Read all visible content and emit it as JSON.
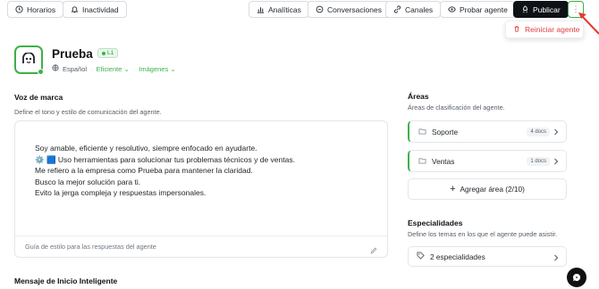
{
  "toolbar": {
    "horarios": "Horarios",
    "inactividad": "Inactividad",
    "analiticas": "Analíticas",
    "conversaciones": "Conversaciones",
    "canales": "Canales",
    "probar": "Probar agente",
    "publicar": "Publicar"
  },
  "dropdown": {
    "reset": "Reiniciar agente"
  },
  "agent": {
    "name": "Prueba",
    "level": "L1",
    "language": "Español",
    "tone": "Eficiente",
    "images": "Imágenes"
  },
  "brand_voice": {
    "title": "Voz de marca",
    "subtitle": "Define el tono y estilo de comunicación del agente.",
    "lines": [
      "Soy amable, eficiente y resolutivo, siempre enfocado en ayudarte.",
      "⚙️ 🟦 Uso herramientas para solucionar tus problemas técnicos y de ventas.",
      "Me refiero a la empresa como Prueba para mantener la claridad.",
      "Busco la mejor solución para ti.",
      "Evito la jerga compleja y respuestas impersonales."
    ],
    "footer": "Guía de estilo para las respuestas del agente"
  },
  "smart_start": {
    "title": "Mensaje de Inicio Inteligente"
  },
  "areas": {
    "title": "Áreas",
    "subtitle": "Áreas de clasificación del agente.",
    "items": [
      {
        "name": "Soporte",
        "docs": "4 docs"
      },
      {
        "name": "Ventas",
        "docs": "1 docs"
      }
    ],
    "add": "Agregar área (2/10)"
  },
  "specialties": {
    "title": "Especialidades",
    "subtitle": "Define los temas en los que el agente puede asistir.",
    "value": "2 especialidades"
  },
  "colors": {
    "accent": "#3eb049",
    "danger": "#e0413f",
    "dark": "#0e1116"
  }
}
